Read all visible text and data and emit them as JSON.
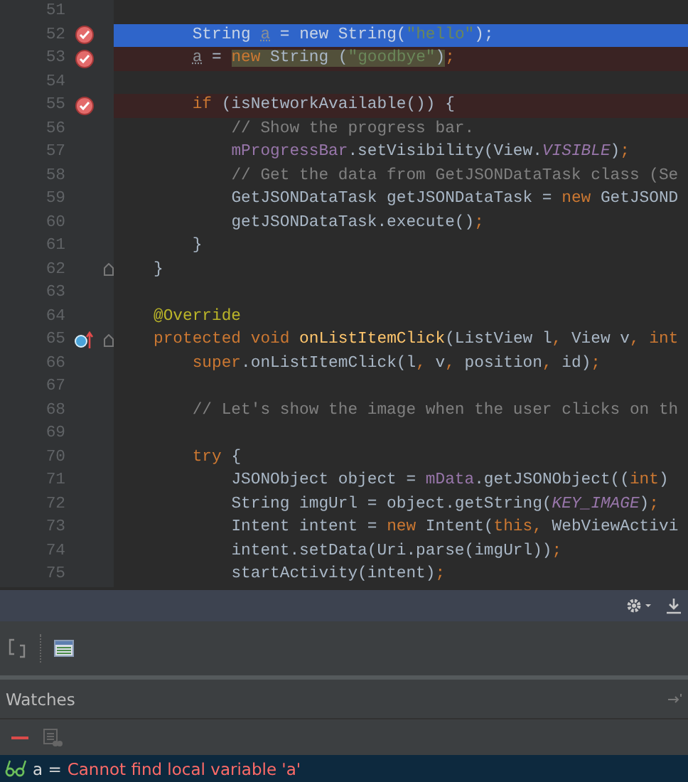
{
  "editor": {
    "lines": [
      {
        "number": "51",
        "selected": false,
        "breakpoint": false,
        "override": false,
        "fold": false
      },
      {
        "number": "52",
        "selected": true,
        "breakpoint": true,
        "override": false,
        "fold": false,
        "segments": [
          {
            "kind": "plain",
            "text": "    String ",
            "marked": false
          },
          {
            "kind": "unused",
            "text": "a",
            "marked": false
          },
          {
            "kind": "plain",
            "text": " = ",
            "marked": false
          },
          {
            "kind": "keyword",
            "text": "new",
            "marked": false
          },
          {
            "kind": "plain",
            "text": " String(",
            "marked": false
          },
          {
            "kind": "string",
            "text": "\"hello\"",
            "marked": false
          },
          {
            "kind": "plain",
            "text": ")",
            "marked": false
          },
          {
            "kind": "keyword",
            "text": ";",
            "marked": false
          }
        ]
      },
      {
        "number": "53",
        "selected": false,
        "breakpoint": true,
        "override": false,
        "fold": false,
        "segments": [
          {
            "kind": "unused",
            "text": "    a",
            "marked": false
          },
          {
            "kind": "plain",
            "text": " = ",
            "marked": false
          },
          {
            "kind": "keyword",
            "text": "new",
            "marked": true
          },
          {
            "kind": "plain",
            "text": " String (",
            "marked": true
          },
          {
            "kind": "string",
            "text": "\"goodbye\"",
            "marked": true
          },
          {
            "kind": "plain",
            "text": ")",
            "marked": true
          },
          {
            "kind": "keyword",
            "text": ";",
            "marked": false
          }
        ]
      },
      {
        "number": "54",
        "selected": false,
        "breakpoint": false,
        "override": false,
        "fold": false
      },
      {
        "number": "55",
        "selected": false,
        "breakpoint": true,
        "override": false,
        "fold": false,
        "segments": [
          {
            "kind": "keyword",
            "text": "    if",
            "marked": false
          },
          {
            "kind": "plain",
            "text": " (isNetworkAvailable()) {",
            "marked": false
          }
        ]
      },
      {
        "number": "56",
        "selected": false,
        "breakpoint": false,
        "override": false,
        "fold": false,
        "segments": [
          {
            "kind": "comment",
            "text": "        // Show the progress bar.",
            "marked": false
          }
        ]
      },
      {
        "number": "57",
        "selected": false,
        "breakpoint": false,
        "override": false,
        "fold": false,
        "segments": [
          {
            "kind": "field",
            "text": "        mProgressBar",
            "marked": false
          },
          {
            "kind": "plain",
            "text": ".setVisibility(View.",
            "marked": false
          },
          {
            "kind": "constant",
            "text": "VISIBLE",
            "marked": false
          },
          {
            "kind": "plain",
            "text": ")",
            "marked": false
          },
          {
            "kind": "keyword",
            "text": ";",
            "marked": false
          }
        ]
      },
      {
        "number": "58",
        "selected": false,
        "breakpoint": false,
        "override": false,
        "fold": false,
        "segments": [
          {
            "kind": "comment",
            "text": "        // Get the data from GetJSONDataTask class (Se",
            "marked": false
          }
        ]
      },
      {
        "number": "59",
        "selected": false,
        "breakpoint": false,
        "override": false,
        "fold": false,
        "segments": [
          {
            "kind": "plain",
            "text": "        GetJSONDataTask getJSONDataTask = ",
            "marked": false
          },
          {
            "kind": "keyword",
            "text": "new",
            "marked": false
          },
          {
            "kind": "plain",
            "text": " GetJSOND",
            "marked": false
          }
        ]
      },
      {
        "number": "60",
        "selected": false,
        "breakpoint": false,
        "override": false,
        "fold": false,
        "segments": [
          {
            "kind": "plain",
            "text": "        getJSONDataTask.execute()",
            "marked": false
          },
          {
            "kind": "keyword",
            "text": ";",
            "marked": false
          }
        ]
      },
      {
        "number": "61",
        "selected": false,
        "breakpoint": false,
        "override": false,
        "fold": false,
        "segments": [
          {
            "kind": "plain",
            "text": "    }",
            "marked": false
          }
        ]
      },
      {
        "number": "62",
        "selected": false,
        "breakpoint": false,
        "override": false,
        "fold": true,
        "segments": [
          {
            "kind": "plain",
            "text": "}",
            "marked": false
          }
        ]
      },
      {
        "number": "63",
        "selected": false,
        "breakpoint": false,
        "override": false,
        "fold": false
      },
      {
        "number": "64",
        "selected": false,
        "breakpoint": false,
        "override": false,
        "fold": false,
        "segments": [
          {
            "kind": "annotation",
            "text": "@Override",
            "marked": false
          }
        ]
      },
      {
        "number": "65",
        "selected": false,
        "breakpoint": false,
        "override": true,
        "fold": true,
        "segments": [
          {
            "kind": "keyword",
            "text": "protected void ",
            "marked": false
          },
          {
            "kind": "method",
            "text": "onListItemClick",
            "marked": false
          },
          {
            "kind": "plain",
            "text": "(ListView l",
            "marked": false
          },
          {
            "kind": "keyword",
            "text": ",",
            "marked": false
          },
          {
            "kind": "plain",
            "text": " View v",
            "marked": false
          },
          {
            "kind": "keyword",
            "text": ",",
            "marked": false
          },
          {
            "kind": "keyword",
            "text": " int",
            "marked": false
          }
        ]
      },
      {
        "number": "66",
        "selected": false,
        "breakpoint": false,
        "override": false,
        "fold": false,
        "segments": [
          {
            "kind": "keyword",
            "text": "    super",
            "marked": false
          },
          {
            "kind": "plain",
            "text": ".onListItemClick(l",
            "marked": false
          },
          {
            "kind": "keyword",
            "text": ",",
            "marked": false
          },
          {
            "kind": "plain",
            "text": " v",
            "marked": false
          },
          {
            "kind": "keyword",
            "text": ",",
            "marked": false
          },
          {
            "kind": "plain",
            "text": " position",
            "marked": false
          },
          {
            "kind": "keyword",
            "text": ",",
            "marked": false
          },
          {
            "kind": "plain",
            "text": " id)",
            "marked": false
          },
          {
            "kind": "keyword",
            "text": ";",
            "marked": false
          }
        ]
      },
      {
        "number": "67",
        "selected": false,
        "breakpoint": false,
        "override": false,
        "fold": false
      },
      {
        "number": "68",
        "selected": false,
        "breakpoint": false,
        "override": false,
        "fold": false,
        "segments": [
          {
            "kind": "comment",
            "text": "    // Let's show the image when the user clicks on th",
            "marked": false
          }
        ]
      },
      {
        "number": "69",
        "selected": false,
        "breakpoint": false,
        "override": false,
        "fold": false
      },
      {
        "number": "70",
        "selected": false,
        "breakpoint": false,
        "override": false,
        "fold": false,
        "segments": [
          {
            "kind": "keyword",
            "text": "    try",
            "marked": false
          },
          {
            "kind": "plain",
            "text": " {",
            "marked": false
          }
        ]
      },
      {
        "number": "71",
        "selected": false,
        "breakpoint": false,
        "override": false,
        "fold": false,
        "segments": [
          {
            "kind": "plain",
            "text": "        JSONObject object = ",
            "marked": false
          },
          {
            "kind": "field",
            "text": "mData",
            "marked": false
          },
          {
            "kind": "plain",
            "text": ".getJSONObject((",
            "marked": false
          },
          {
            "kind": "keyword",
            "text": "int",
            "marked": false
          },
          {
            "kind": "plain",
            "text": ")",
            "marked": false
          }
        ]
      },
      {
        "number": "72",
        "selected": false,
        "breakpoint": false,
        "override": false,
        "fold": false,
        "segments": [
          {
            "kind": "plain",
            "text": "        String imgUrl = object.getString(",
            "marked": false
          },
          {
            "kind": "constant",
            "text": "KEY_IMAGE",
            "marked": false
          },
          {
            "kind": "plain",
            "text": ")",
            "marked": false
          },
          {
            "kind": "keyword",
            "text": ";",
            "marked": false
          }
        ]
      },
      {
        "number": "73",
        "selected": false,
        "breakpoint": false,
        "override": false,
        "fold": false,
        "segments": [
          {
            "kind": "plain",
            "text": "        Intent intent = ",
            "marked": false
          },
          {
            "kind": "keyword",
            "text": "new",
            "marked": false
          },
          {
            "kind": "plain",
            "text": " Intent(",
            "marked": false
          },
          {
            "kind": "keyword",
            "text": "this,",
            "marked": false
          },
          {
            "kind": "plain",
            "text": " WebViewActivi",
            "marked": false
          }
        ]
      },
      {
        "number": "74",
        "selected": false,
        "breakpoint": false,
        "override": false,
        "fold": false,
        "segments": [
          {
            "kind": "plain",
            "text": "        intent.setData(Uri.parse(imgUrl))",
            "marked": false
          },
          {
            "kind": "keyword",
            "text": ";",
            "marked": false
          }
        ]
      },
      {
        "number": "75",
        "selected": false,
        "breakpoint": false,
        "override": false,
        "fold": false,
        "segments": [
          {
            "kind": "plain",
            "text": "        startActivity(intent)",
            "marked": false
          },
          {
            "kind": "keyword",
            "text": ";",
            "marked": false
          }
        ]
      }
    ]
  },
  "watches": {
    "title": "Watches",
    "items": [
      {
        "name": "a =",
        "value": "Cannot find local variable 'a'",
        "selected": true,
        "error": true
      }
    ]
  }
}
